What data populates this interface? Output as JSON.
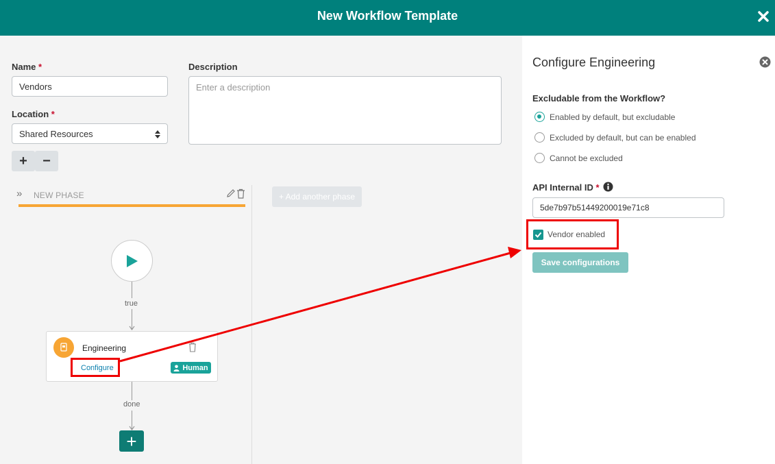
{
  "header": {
    "title": "New Workflow Template"
  },
  "form": {
    "name_label": "Name",
    "name_value": "Vendors",
    "description_label": "Description",
    "description_placeholder": "Enter a description",
    "location_label": "Location",
    "location_value": "Shared Resources",
    "required_mark": "*",
    "plus_label": "+",
    "minus_label": "−"
  },
  "phase": {
    "chevron": "»",
    "name": "NEW PHASE",
    "add_label": "+ Add another phase",
    "accent_color": "#f7a534"
  },
  "flow": {
    "edge_true_label": "true",
    "edge_done_label": "done",
    "node": {
      "title": "Engineering",
      "configure_label": "Configure",
      "badge_label": "Human"
    },
    "add_node_label": "+"
  },
  "config_panel": {
    "title": "Configure Engineering",
    "excludable_label": "Excludable from the Workflow?",
    "options": [
      {
        "label": "Enabled by default, but excludable",
        "selected": true
      },
      {
        "label": "Excluded by default, but can be enabled",
        "selected": false
      },
      {
        "label": "Cannot be excluded",
        "selected": false
      }
    ],
    "api_id_label": "API Internal ID",
    "api_id_value": "5de7b97b51449200019e71c8",
    "vendor_enabled_label": "Vendor enabled",
    "vendor_enabled": true,
    "save_label": "Save configurations"
  },
  "colors": {
    "brand": "#00807c",
    "accent": "#1aa39a",
    "highlight": "#ee0000"
  }
}
